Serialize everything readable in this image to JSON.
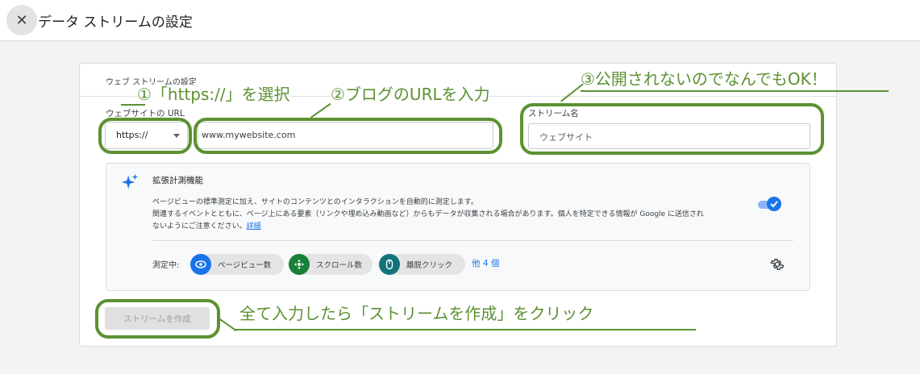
{
  "header": {
    "close_icon": "close-icon",
    "title": "データ ストリームの設定"
  },
  "form": {
    "section_title": "ウェブ ストリームの設定",
    "url_label": "ウェブサイトの URL",
    "protocol_value": "https://",
    "url_value": "www.mywebsite.com",
    "stream_name_label": "ストリーム名",
    "stream_name_placeholder": "ウェブサイト"
  },
  "enhanced": {
    "title": "拡張計測機能",
    "desc_line1": "ページビューの標準測定に加え、サイトのコンテンツとのインタラクションを自動的に測定します。",
    "desc_line2": "関連するイベントとともに、ページ上にある要素（リンクや埋め込み動画など）からもデータが収集される場合があります。個人を特定できる情報が Google に送信され",
    "desc_line3": "ないようにご注意ください。",
    "desc_link": "詳細",
    "toggle_on": true,
    "measuring_label": "測定中:",
    "chips": [
      {
        "label": "ページビュー数",
        "icon": "eye-icon",
        "color": "#1a73e8"
      },
      {
        "label": "スクロール数",
        "icon": "scroll-icon",
        "color": "#188038"
      },
      {
        "label": "離脱クリック",
        "icon": "mouse-icon",
        "color": "#12737d"
      }
    ],
    "more_label": "他 4 個"
  },
  "actions": {
    "create_label": "ストリームを作成"
  },
  "annotations": {
    "a1": "①「https://」を選択",
    "a2": "②ブログのURLを入力",
    "a3": "③公開されないのでなんでもOK！",
    "a4": "全て入力したら「ストリームを作成」をクリック",
    "color": "#5c9132"
  }
}
